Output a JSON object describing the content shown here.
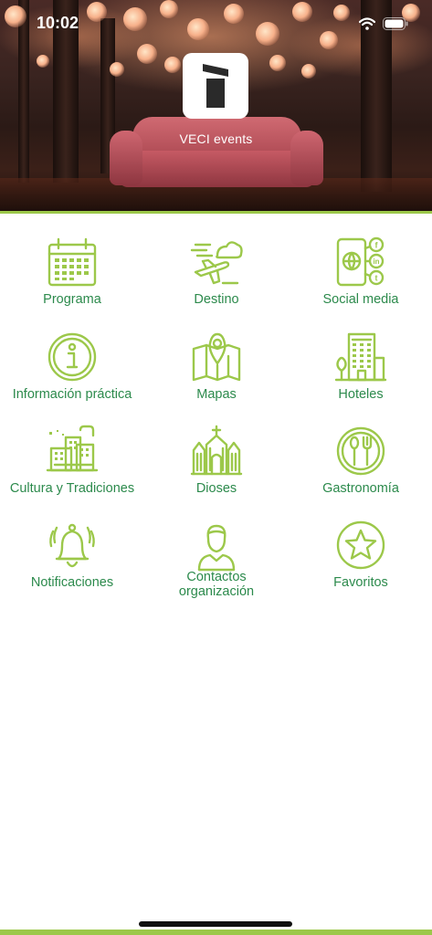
{
  "status_bar": {
    "time": "10:02"
  },
  "header": {
    "app_name": "VECI events"
  },
  "menu": [
    {
      "label": "Programa",
      "icon": "calendar-icon"
    },
    {
      "label": "Destino",
      "icon": "plane-cloud-icon"
    },
    {
      "label": "Social media",
      "icon": "social-media-icon"
    },
    {
      "label": "Información práctica",
      "icon": "info-icon"
    },
    {
      "label": "Mapas",
      "icon": "map-icon"
    },
    {
      "label": "Hoteles",
      "icon": "hotel-icon"
    },
    {
      "label": "Cultura y Tradiciones",
      "icon": "city-culture-icon"
    },
    {
      "label": "Dioses",
      "icon": "cathedral-icon"
    },
    {
      "label": "Gastronomía",
      "icon": "plate-cutlery-icon"
    },
    {
      "label": "Notificaciones",
      "icon": "bell-icon"
    },
    {
      "label": "Contactos organización",
      "icon": "person-icon"
    },
    {
      "label": "Favoritos",
      "icon": "star-icon"
    }
  ],
  "colors": {
    "accent": "#9cc84a",
    "label": "#2c8a4c"
  }
}
